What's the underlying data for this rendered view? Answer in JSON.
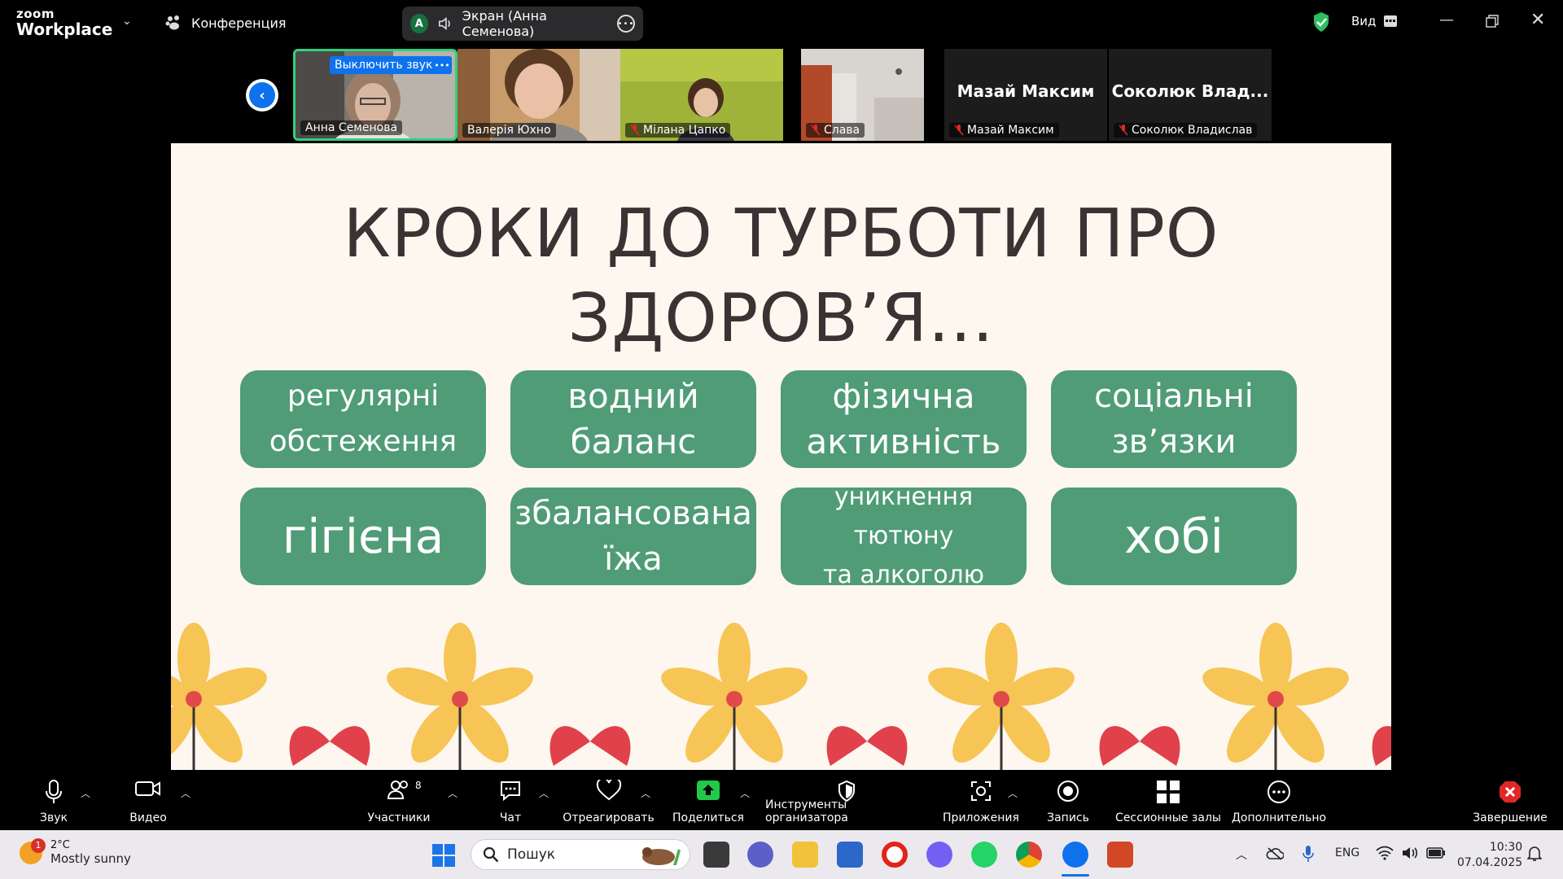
{
  "app": {
    "logo_line1": "zoom",
    "logo_line2": "Workplace",
    "meeting_label": "Конференция"
  },
  "share": {
    "avatar_letter": "A",
    "label": "Экран (Анна Семенова)"
  },
  "view_label": "Вид",
  "participants_strip": {
    "unmute_label": "Выключить звук",
    "tiles": [
      {
        "name": "Анна Семенова"
      },
      {
        "name": "Валерія Юхно"
      },
      {
        "name": "Мілана Цапко"
      },
      {
        "name": "Слава"
      },
      {
        "name": "Мазай Максим",
        "big_name": "Мазай Максим"
      },
      {
        "name": "Соколюк Владислав",
        "big_name": "Соколюк  Влад..."
      }
    ]
  },
  "slide": {
    "title_line1": "КРОКИ ДО ТУРБОТИ ПРО",
    "title_line2": "ЗДОРОВ’Я...",
    "cards": [
      {
        "l1": "регулярні",
        "l2": "обстеження"
      },
      {
        "l1": "водний",
        "l2": "баланс"
      },
      {
        "l1": "фізична",
        "l2": "активність"
      },
      {
        "l1": "соціальні",
        "l2": "зв’язки"
      },
      {
        "l1": "гігієна"
      },
      {
        "l1": "збалансована",
        "l2": "їжа"
      },
      {
        "l1": "уникнення тютюну",
        "l2": "та алкоголю"
      },
      {
        "l1": "хобі"
      }
    ]
  },
  "toolbar": {
    "audio": "Звук",
    "video": "Видео",
    "participants": "Участники",
    "participants_count": "8",
    "chat": "Чат",
    "react": "Отреагировать",
    "share": "Поделиться",
    "host_tools": "Инструменты организатора",
    "apps": "Приложения",
    "record": "Запись",
    "breakout": "Сессионные залы",
    "more": "Дополнительно",
    "end": "Завершение"
  },
  "taskbar": {
    "weather_badge": "1",
    "temperature": "2°C",
    "weather_text": "Mostly sunny",
    "search_placeholder": "Пошук",
    "lang": "ENG",
    "time": "10:30",
    "date": "07.04.2025"
  },
  "colors": {
    "accent": "#0e72ed",
    "card": "#4f9c77",
    "slide_bg": "#fdf7ef",
    "active_border": "#2fd17a",
    "end_red": "#e02828"
  }
}
